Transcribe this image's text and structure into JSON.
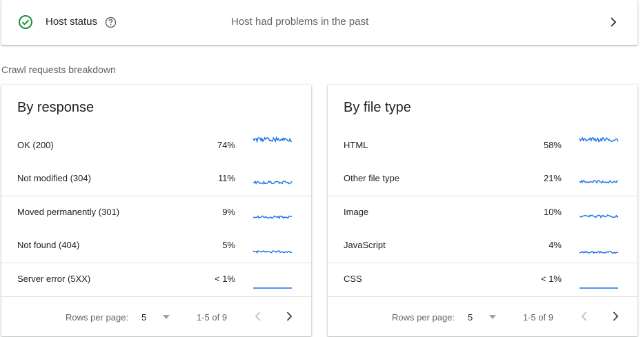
{
  "host": {
    "title": "Host status",
    "status_text": "Host had problems in the past",
    "accent_color": "#1e8e3e"
  },
  "section_label": "Crawl requests breakdown",
  "cards": [
    {
      "title": "By response",
      "rows": [
        {
          "label": "OK (200)",
          "pct": "74%",
          "level": 0.9
        },
        {
          "label": "Not modified (304)",
          "pct": "11%",
          "level": 0.3
        },
        {
          "label": "Moved permanently (301)",
          "pct": "9%",
          "level": 0.25
        },
        {
          "label": "Not found (404)",
          "pct": "5%",
          "level": 0.15
        },
        {
          "label": "Server error (5XX)",
          "pct": "< 1%",
          "level": 0.0
        }
      ],
      "footer": {
        "rows_per_page_label": "Rows per page:",
        "rows_per_page_value": "5",
        "range": "1-5 of 9"
      }
    },
    {
      "title": "By file type",
      "rows": [
        {
          "label": "HTML",
          "pct": "58%",
          "level": 0.9
        },
        {
          "label": "Other file type",
          "pct": "21%",
          "level": 0.35
        },
        {
          "label": "Image",
          "pct": "10%",
          "level": 0.3
        },
        {
          "label": "JavaScript",
          "pct": "4%",
          "level": 0.12
        },
        {
          "label": "CSS",
          "pct": "< 1%",
          "level": 0.0
        }
      ],
      "footer": {
        "rows_per_page_label": "Rows per page:",
        "rows_per_page_value": "5",
        "range": "1-5 of 9"
      }
    }
  ],
  "sparkline_color": "#1a73e8"
}
